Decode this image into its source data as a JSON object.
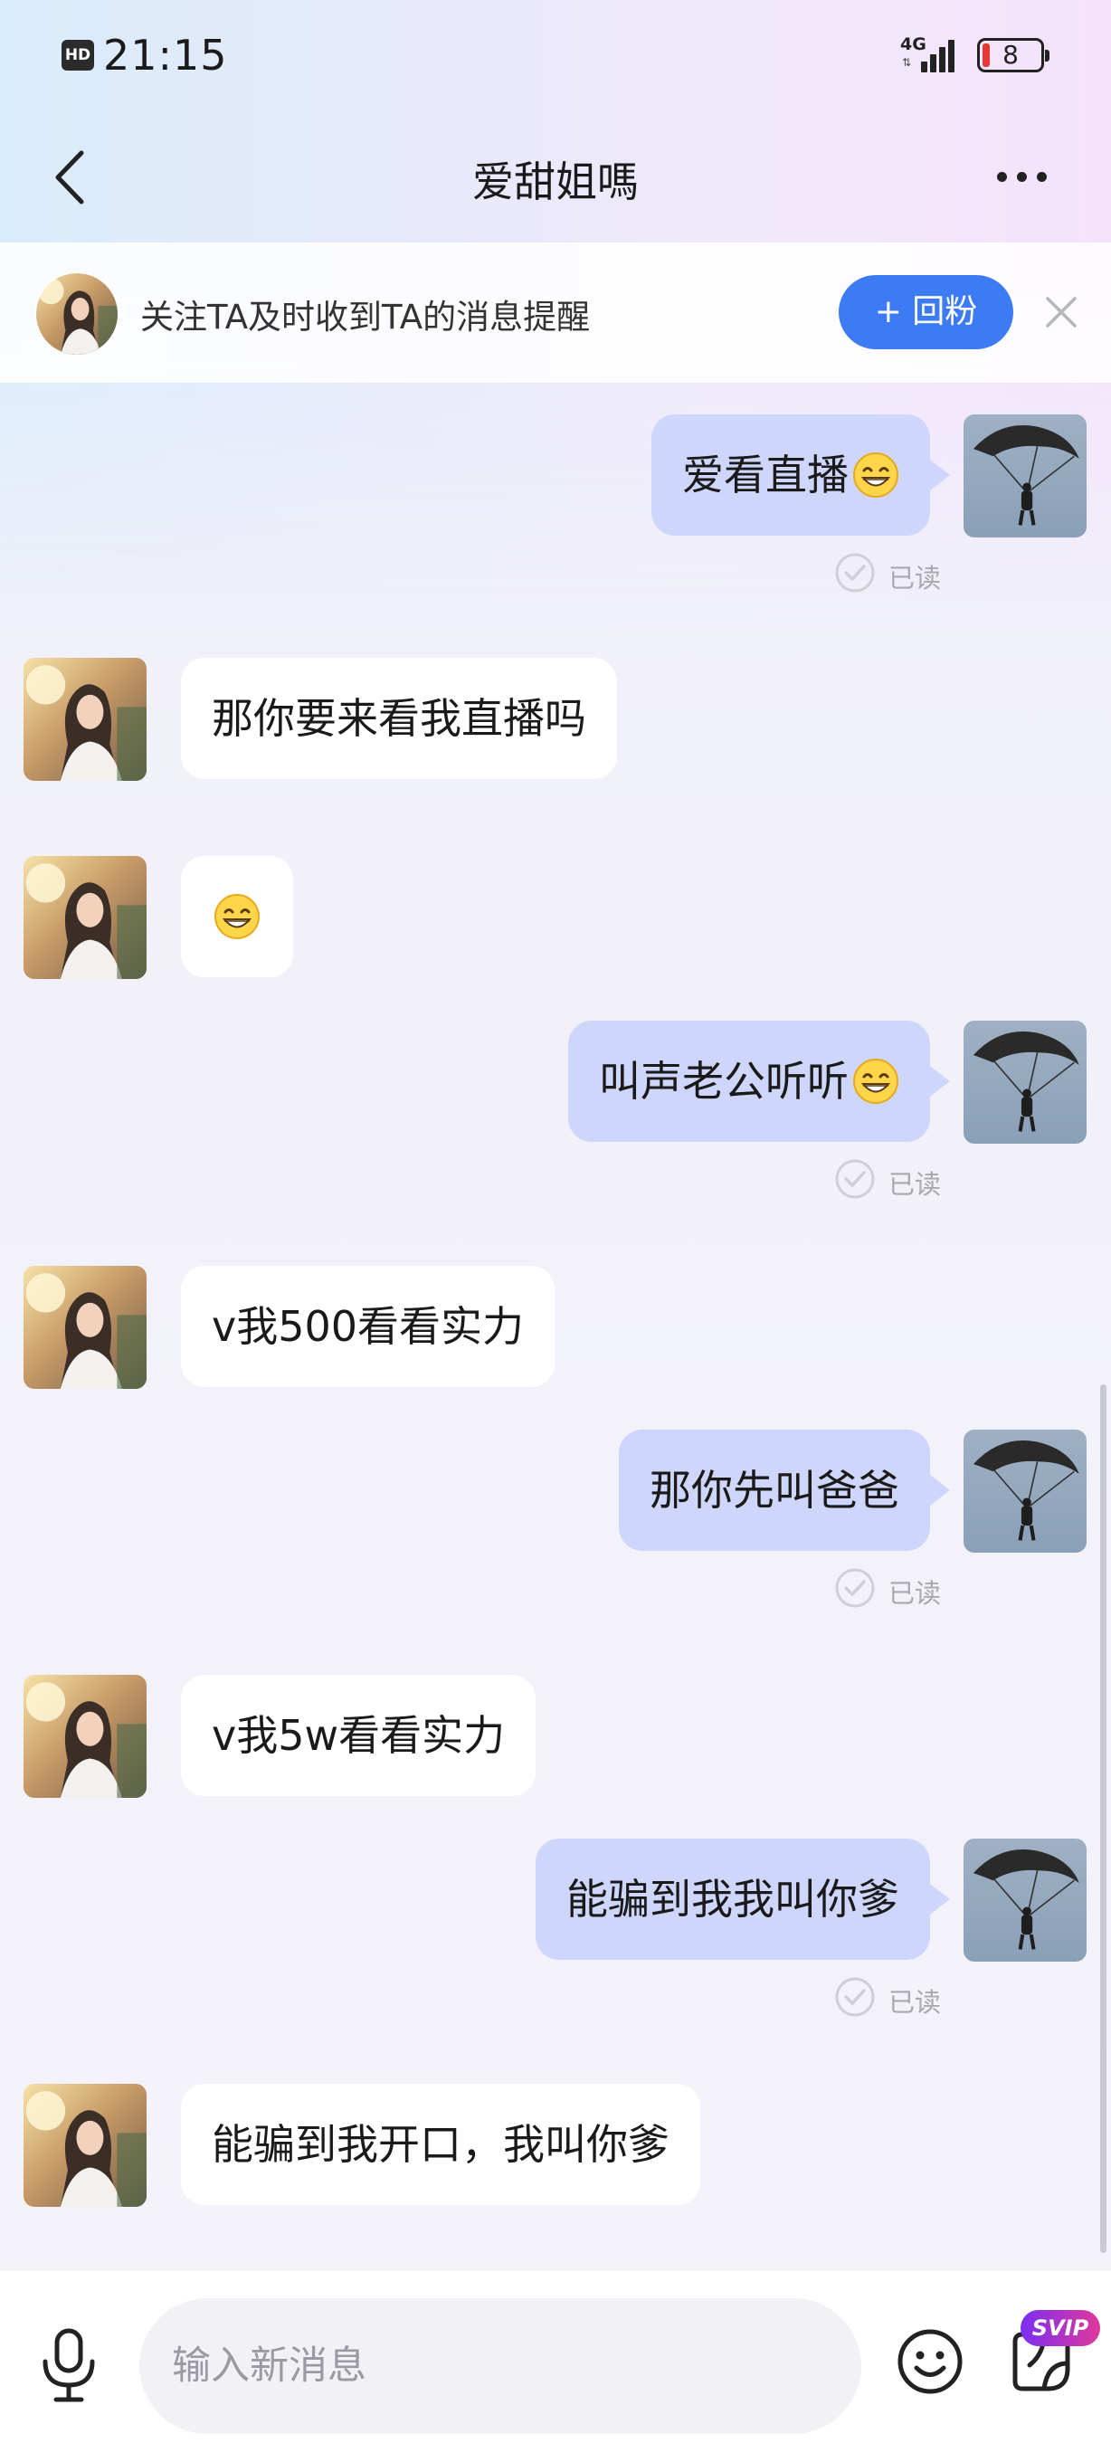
{
  "status_bar": {
    "hd": "HD",
    "time": "21:15",
    "network": "4G",
    "battery": "8"
  },
  "header": {
    "title": "爱甜姐嗎"
  },
  "follow_banner": {
    "text": "关注TA及时收到TA的消息提醒",
    "button_label": "+ 回粉"
  },
  "messages": [
    {
      "side": "out",
      "text": "爱看直播",
      "emoji": "grinning",
      "read": "已读"
    },
    {
      "side": "in",
      "text": "那你要来看我直播吗"
    },
    {
      "side": "in",
      "text": "",
      "emoji": "grinning"
    },
    {
      "side": "out",
      "text": "叫声老公听听",
      "emoji": "grinning",
      "read": "已读"
    },
    {
      "side": "in",
      "text": "v我500看看实力"
    },
    {
      "side": "out",
      "text": "那你先叫爸爸",
      "read": "已读"
    },
    {
      "side": "in",
      "text": "v我5w看看实力"
    },
    {
      "side": "out",
      "text": "能骗到我我叫你爹",
      "read": "已读"
    },
    {
      "side": "in",
      "text": "能骗到我开口，我叫你爹"
    }
  ],
  "input_bar": {
    "placeholder": "输入新消息",
    "svip": "SVIP"
  },
  "icons": [
    "back-arrow-icon",
    "more-dots-icon",
    "close-icon",
    "check-circle-icon",
    "microphone-icon",
    "emoji-face-icon",
    "sticker-icon",
    "grinning-emoji-icon"
  ],
  "colors": {
    "accent": "#3d7bf5",
    "outgoing_bubble": "#cfd6fb",
    "incoming_bubble": "#ffffff",
    "read_text": "#a8a8b0"
  }
}
